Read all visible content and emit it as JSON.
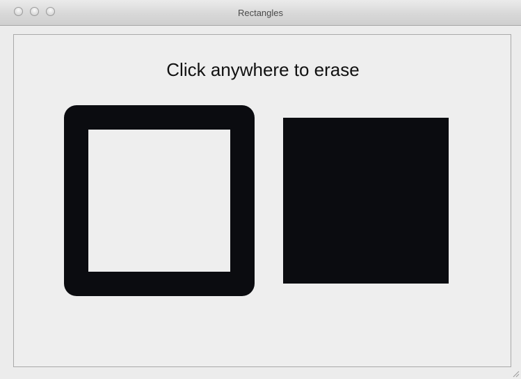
{
  "window": {
    "title": "Rectangles"
  },
  "canvas": {
    "instruction": "Click anywhere to erase",
    "shape_color": "#0b0c10",
    "background_color": "#eeeeee"
  }
}
